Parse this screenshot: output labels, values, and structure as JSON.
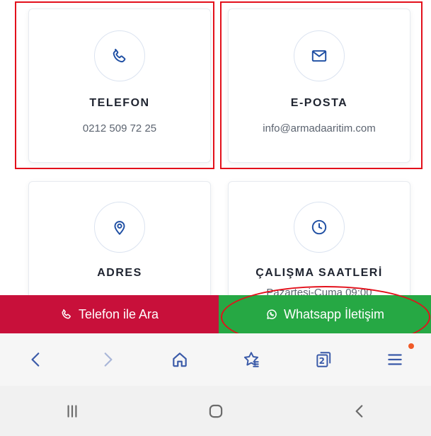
{
  "cards": [
    {
      "title": "TELEFON",
      "value": "0212 509 72 25",
      "icon": "phone-icon"
    },
    {
      "title": "E-POSTA",
      "value": "info@armadaaritim.com",
      "icon": "mail-icon"
    },
    {
      "title": "ADRES",
      "value": "",
      "icon": "location-pin-icon"
    },
    {
      "title": "ÇALIŞMA SAATLERİ",
      "value": "Pazartesi-Cuma 09:00",
      "icon": "clock-icon"
    }
  ],
  "action_bar": {
    "call_label": "Telefon ile Ara",
    "whatsapp_label": "Whatsapp İletişim"
  },
  "browser_toolbar": {
    "tab_count": "2",
    "items": [
      "back-icon",
      "forward-icon",
      "home-icon",
      "bookmarks-icon",
      "tabs-icon",
      "menu-icon"
    ]
  },
  "system_nav": {
    "items": [
      "recent-apps-icon",
      "home-button-icon",
      "back-button-icon"
    ]
  },
  "colors": {
    "call_bg": "#c8103a",
    "whatsapp_bg": "#26a844",
    "accent": "#1f4fa3",
    "highlight": "#e3101b"
  }
}
